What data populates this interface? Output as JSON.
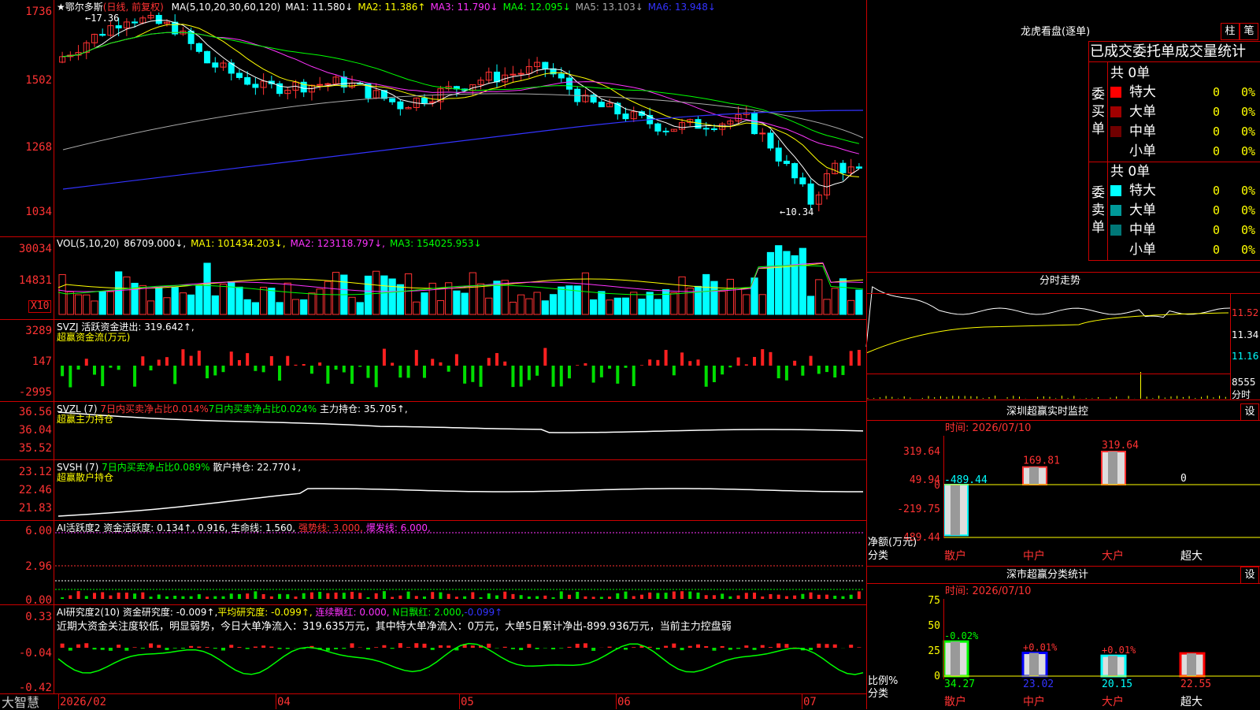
{
  "stock": {
    "star": "★",
    "name": "鄂尔多斯",
    "mode": "(日线, 前复权)"
  },
  "ma_legend": [
    {
      "label": "MA(5,10,20,30,60,120)",
      "color": "#ffffff"
    },
    {
      "label": "MA1: 11.580↓",
      "color": "#ffffff"
    },
    {
      "label": "MA2: 11.386↑",
      "color": "#ffff00"
    },
    {
      "label": "MA3: 11.790↓",
      "color": "#ff33ff"
    },
    {
      "label": "MA4: 12.095↓",
      "color": "#00ff00"
    },
    {
      "label": "MA5: 13.103↓",
      "color": "#aaaaaa"
    },
    {
      "label": "MA6: 13.948↓",
      "color": "#3333ff"
    }
  ],
  "price_axis": [
    "1736",
    "1502",
    "1268",
    "1034"
  ],
  "price_marks": {
    "high": "17.36",
    "low": "10.34"
  },
  "vol_legend": [
    {
      "label": "VOL(5,10,20)",
      "color": "#ffffff"
    },
    {
      "label": "86709.000↓,",
      "color": "#ffffff"
    },
    {
      "label": "MA1: 101434.203↓,",
      "color": "#ffff00"
    },
    {
      "label": "MA2: 123118.797↓,",
      "color": "#ff33ff"
    },
    {
      "label": "MA3: 154025.953↓",
      "color": "#00ff00"
    }
  ],
  "vol_axis": [
    "30034",
    "14831"
  ],
  "vol_unit": "X10",
  "svzj": {
    "line1": "SVZJ  活跃资金进出: 319.642↑,",
    "line2": "超赢资金流(万元)",
    "axis": [
      "3289",
      "147",
      "-2995"
    ]
  },
  "svzl": {
    "p1": "SVZL (7)",
    "p2": "7日内买卖净占比0.014%",
    "p3": "7日内买卖净占比0.024%",
    "p4": "主力持仓: 35.705↑,",
    "line2": "超赢主力持仓",
    "axis": [
      "36.56",
      "36.04",
      "35.52"
    ]
  },
  "svsh": {
    "p1": "SVSH (7)",
    "p2": "7日内买卖净占比0.089%",
    "p3": "散户持仓: 22.770↓,",
    "line2": "超赢散户持仓",
    "axis": [
      "23.12",
      "22.46",
      "21.83"
    ]
  },
  "ai1": {
    "p1": "AI活跃度2",
    "p2": "资金活跃度: 0.134↑, 0.916, 生命线: 1.560,",
    "p3": "强势线: 3.000,",
    "p4": "爆发线: 6.000,",
    "axis": [
      "6.00",
      "2.96",
      "0.00"
    ]
  },
  "ai2": {
    "p1": "AI研究度2(10)",
    "p2": "资金研究度: -0.009↑,",
    "p3": "平均研究度: -0.099↑,",
    "p4": "连续飘红: 0.000,",
    "p5": "N日飘红: 2.000,",
    "p6": "-0.099↑",
    "comment": "近期大资金关注度较低，明显弱势，今日大单净流入：319.635万元，其中特大单净流入：0万元，大单5日累计净出-899.936万元，当前主力控盘弱",
    "axis": [
      "0.33",
      "-0.04",
      "-0.42"
    ]
  },
  "bottom_bar": {
    "brand": "大智慧",
    "dates": [
      "2026/02",
      "04",
      "05",
      "06",
      "07"
    ]
  },
  "dragon": {
    "title": "龙虎看盘(逐单)",
    "btn1": "柱",
    "btn2": "笔",
    "header": "已成交委托单成交量统计",
    "buy": {
      "side": "委买单",
      "total": "共 0单",
      "rows": [
        {
          "name": "特大",
          "v": "0",
          "p": "0%",
          "c": "#ff0000"
        },
        {
          "name": "大单",
          "v": "0",
          "p": "0%",
          "c": "#a00000"
        },
        {
          "name": "中单",
          "v": "0",
          "p": "0%",
          "c": "#700000"
        },
        {
          "name": "小单",
          "v": "0",
          "p": "0%",
          "c": "#000000"
        }
      ]
    },
    "sell": {
      "side": "委卖单",
      "total": "共 0单",
      "rows": [
        {
          "name": "特大",
          "v": "0",
          "p": "0%",
          "c": "#00ffff"
        },
        {
          "name": "大单",
          "v": "0",
          "p": "0%",
          "c": "#009999"
        },
        {
          "name": "中单",
          "v": "0",
          "p": "0%",
          "c": "#007777"
        },
        {
          "name": "小单",
          "v": "0",
          "p": "0%",
          "c": "#000000"
        }
      ]
    }
  },
  "intraday": {
    "title": "分时走势",
    "axis": [
      "11.52",
      "11.34",
      "11.16",
      "8555",
      "分时"
    ]
  },
  "monitor": {
    "title": "深圳超赢实时监控",
    "btn": "设",
    "time": "时间: 2026/07/10",
    "axis": [
      "319.64",
      "49.94",
      "0",
      "-219.75",
      "-489.44"
    ],
    "ylabel": "净额(万元)",
    "xlabel": "分类",
    "bars": [
      {
        "cat": "散户",
        "value": -489.44,
        "label": "-489.44"
      },
      {
        "cat": "中户",
        "value": 169.81,
        "label": "169.81"
      },
      {
        "cat": "大户",
        "value": 319.64,
        "label": "319.64"
      },
      {
        "cat": "超大",
        "value": 0,
        "label": "0"
      }
    ]
  },
  "stat": {
    "title": "深市超赢分类统计",
    "btn": "设",
    "time": "时间: 2026/07/10",
    "axis": [
      "75",
      "50",
      "25",
      "0"
    ],
    "ylabel": "比例%",
    "xlabel": "分类",
    "bars": [
      {
        "cat": "散户",
        "value": 34.27,
        "top": "-0.02%",
        "val": "34.27",
        "color": "#00ff00"
      },
      {
        "cat": "中户",
        "value": 23.02,
        "top": "+0.01%",
        "val": "23.02",
        "color": "#0000ff"
      },
      {
        "cat": "大户",
        "value": 20.15,
        "top": "+0.01%",
        "val": "20.15",
        "color": "#00ffff"
      },
      {
        "cat": "超大",
        "value": 22.55,
        "top": "",
        "val": "22.55",
        "color": "#ff0000"
      }
    ]
  }
}
